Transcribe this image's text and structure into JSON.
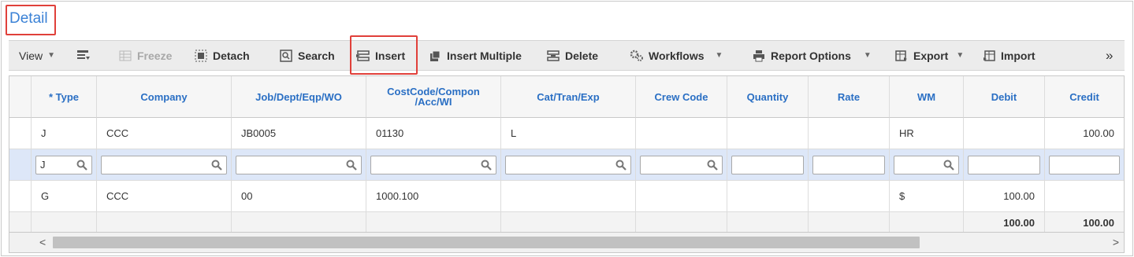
{
  "title": "Detail",
  "toolbar": {
    "view": "View",
    "freeze": "Freeze",
    "detach": "Detach",
    "search": "Search",
    "insert": "Insert",
    "insert_multiple": "Insert Multiple",
    "delete": "Delete",
    "workflows": "Workflows",
    "report_options": "Report Options",
    "export": "Export",
    "import": "Import",
    "more": "»"
  },
  "columns": [
    "* Type",
    "Company",
    "Job/Dept/Eqp/WO",
    "CostCode/Compon /Acc/WI",
    "Cat/Tran/Exp",
    "Crew Code",
    "Quantity",
    "Rate",
    "WM",
    "Debit",
    "Credit"
  ],
  "rows": [
    [
      "J",
      "CCC",
      "JB0005",
      "01130",
      "L",
      "",
      "",
      "",
      "HR",
      "",
      "100.00"
    ],
    [
      "G",
      "CCC",
      "00",
      "1000.100",
      "",
      "",
      "",
      "",
      "$",
      "100.00",
      ""
    ]
  ],
  "edit_row": {
    "type_value": "J"
  },
  "totals": {
    "debit": "100.00",
    "credit": "100.00"
  },
  "scroll": {
    "left_arrow": "<",
    "right_arrow": ">"
  },
  "colors": {
    "accent_blue": "#3b82d6",
    "highlight_red": "#e0403a",
    "selected_row": "#dde7f8"
  }
}
